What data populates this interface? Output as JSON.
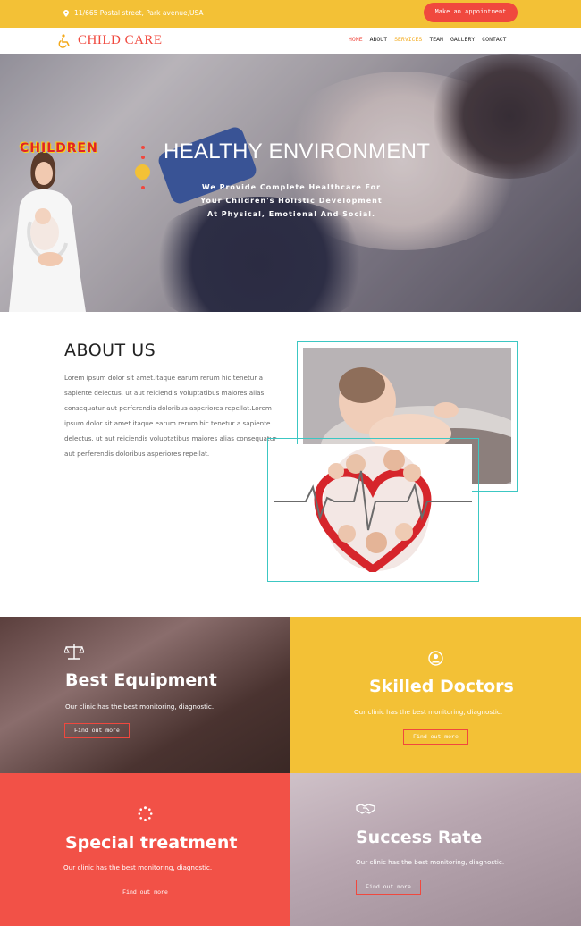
{
  "topbar": {
    "address": "11/665 Postal street, Park avenue,USA",
    "appointment_label": "Make an appointment"
  },
  "nav": {
    "brand": "CHILD CARE",
    "items": [
      "HOME",
      "ABOUT",
      "SERVICES",
      "TEAM",
      "GALLERY",
      "CONTACT"
    ]
  },
  "hero": {
    "badge": "CHILDREN",
    "title": "HEALTHY ENVIRONMENT",
    "subtitle_lines": [
      "We Provide Complete Healthcare For",
      "Your Children's Holistic Development",
      "At Physical, Emotional And Social."
    ]
  },
  "about": {
    "title": "ABOUT US",
    "text": "Lorem ipsum dolor sit amet.itaque earum rerum hic tenetur a sapiente delectus. ut aut reiciendis voluptatibus maiores alias consequatur aut perferendis doloribus asperiores repellat.Lorem ipsum dolor sit amet.itaque earum rerum hic tenetur a sapiente delectus. ut aut reiciendis voluptatibus maiores alias consequatur aut perferendis doloribus asperiores repellat."
  },
  "features": [
    {
      "title": "Best Equipment",
      "desc": "Our clinic has the best monitoring, diagnostic.",
      "button": "Find out more",
      "icon": "scale-icon"
    },
    {
      "title": "Skilled Doctors",
      "desc": "Our clinic has the best monitoring, diagnostic.",
      "button": "Find out more",
      "icon": "user-circle-icon"
    },
    {
      "title": "Special treatment",
      "desc": "Our clinic has the best monitoring, diagnostic.",
      "button": "Find out more",
      "icon": "spinner-icon"
    },
    {
      "title": "Success Rate",
      "desc": "Our clinic has the best monitoring, diagnostic.",
      "button": "Find out more",
      "icon": "handshake-icon"
    }
  ],
  "colors": {
    "accent_yellow": "#f3c136",
    "accent_red": "#f0483e",
    "frame_teal": "#3cc7c3"
  }
}
